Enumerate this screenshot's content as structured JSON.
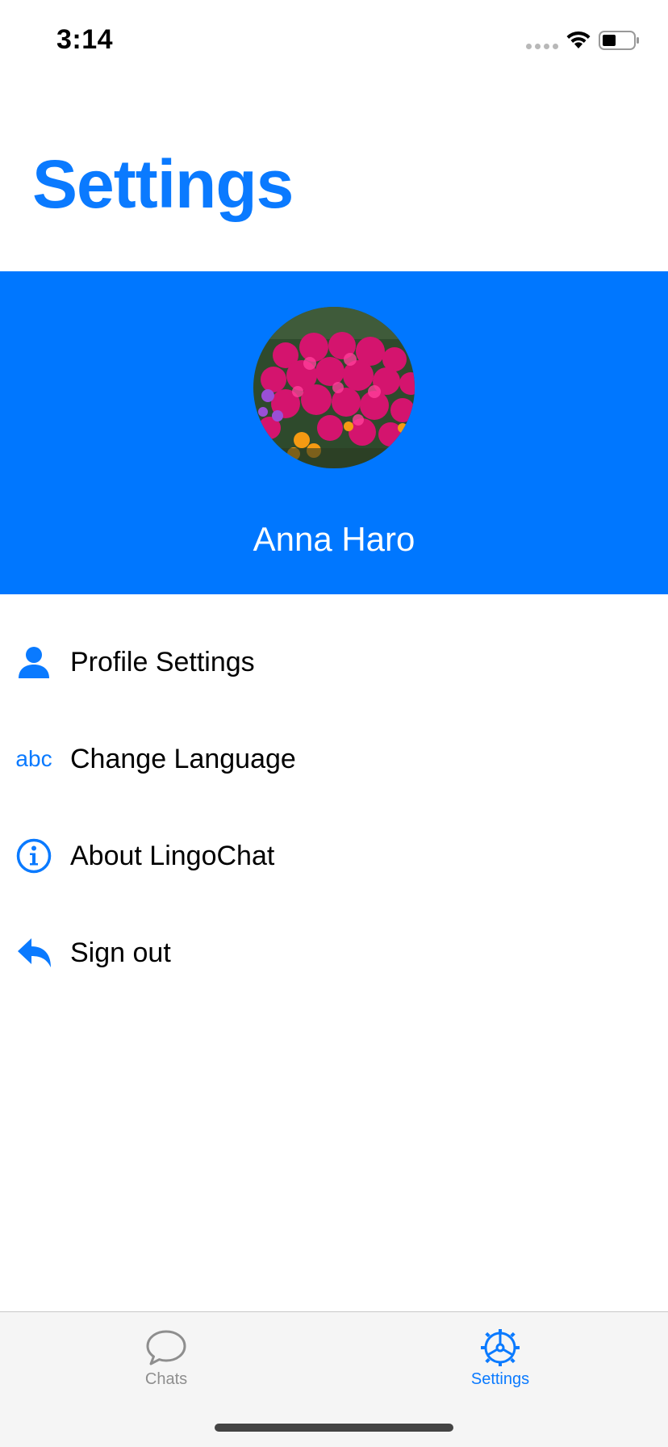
{
  "status_bar": {
    "time": "3:14",
    "icons": [
      "signal-dots-icon",
      "wifi-icon",
      "battery-icon"
    ]
  },
  "header": {
    "title": "Settings"
  },
  "profile": {
    "name": "Anna Haro",
    "avatar": "flower-photo",
    "banner_color": "#0077ff"
  },
  "menu": {
    "items": [
      {
        "label": "Profile Settings",
        "icon": "person-icon"
      },
      {
        "label": "Change Language",
        "icon": "abc-icon",
        "icon_text": "abc"
      },
      {
        "label": "About LingoChat",
        "icon": "info-icon"
      },
      {
        "label": "Sign out",
        "icon": "reply-arrow-icon"
      }
    ]
  },
  "tab_bar": {
    "tabs": [
      {
        "label": "Chats",
        "icon": "chat-bubble-icon",
        "selected": false
      },
      {
        "label": "Settings",
        "icon": "settings-wheel-icon",
        "selected": true
      }
    ]
  },
  "colors": {
    "accent": "#0a7aff",
    "tab_inactive": "#8e8e8e"
  }
}
